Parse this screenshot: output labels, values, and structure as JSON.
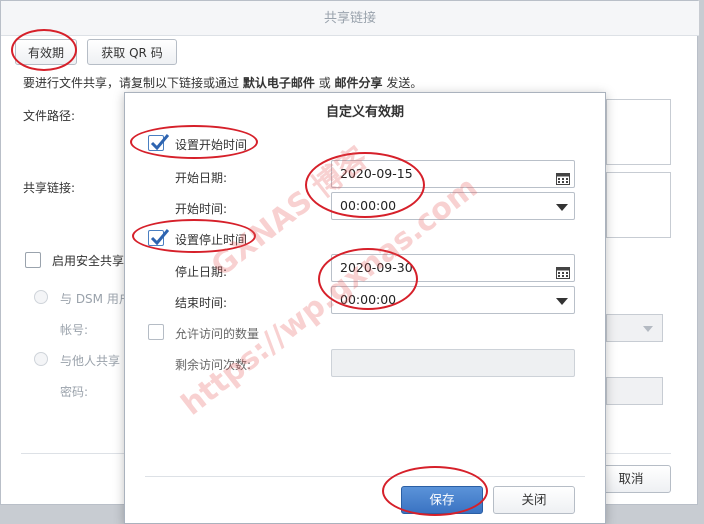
{
  "background_dialog": {
    "title": "共享链接",
    "tab_validity": "有效期",
    "tab_qr": "获取 QR 码",
    "instruction_prefix": "要进行文件共享，请复制以下链接或通过",
    "instruction_email": "默认电子邮件",
    "instruction_or": "或",
    "instruction_mail_share": "邮件分享",
    "instruction_suffix": "发送。",
    "file_path_label": "文件路径:",
    "share_link_label": "共享链接:",
    "secure_share_label": "启用安全共享",
    "radio_dsm_label": "与 DSM 用户",
    "account_label": "帐号:",
    "radio_others_label": "与他人共享",
    "password_label": "密码:",
    "cancel_button": "取消"
  },
  "modal": {
    "title": "自定义有效期",
    "set_start_time": {
      "label": "设置开始时间",
      "checked": true
    },
    "start_date": {
      "label": "开始日期:",
      "value": "2020-09-15"
    },
    "start_time": {
      "label": "开始时间:",
      "value": "00:00:00"
    },
    "set_stop_time": {
      "label": "设置停止时间",
      "checked": true
    },
    "stop_date": {
      "label": "停止日期:",
      "value": "2020-09-30"
    },
    "end_time": {
      "label": "结束时间:",
      "value": "00:00:00"
    },
    "allowed_visits": {
      "label": "允许访问的数量",
      "checked": false
    },
    "remaining_visits": {
      "label": "剩余访问次数:",
      "value": ""
    },
    "save_button": "保存",
    "close_button": "关闭"
  },
  "watermark": {
    "brand": "GXNAS 博客",
    "url": "https://wp.gxnas.com"
  },
  "colors": {
    "accent_blue": "#3a73c2",
    "annotation_red": "#d6202a"
  }
}
